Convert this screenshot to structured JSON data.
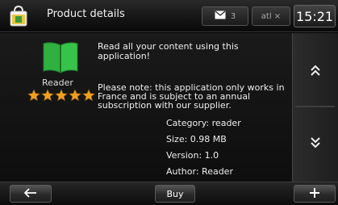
{
  "header": {
    "title": "Product details",
    "messages_count": "3",
    "signal_label": "atl ×",
    "clock": "15:21"
  },
  "product": {
    "name": "Reader",
    "rating": 5,
    "rating_max": 5,
    "description": "Read all your content using this application!",
    "note": "Please note: this application only works in France and is subject to an annual subscription with our supplier.",
    "details": {
      "category": "Category: reader",
      "size": "Size: 0.98 MB",
      "version": "Version: 1.0",
      "author": "Author: Reader"
    }
  },
  "footer": {
    "back_icon": "back-arrow-icon",
    "buy_label": "Buy",
    "add_icon": "plus-icon"
  },
  "colors": {
    "book_green": "#2fb03f",
    "star_orange": "#f0a020",
    "background": "#000000"
  }
}
